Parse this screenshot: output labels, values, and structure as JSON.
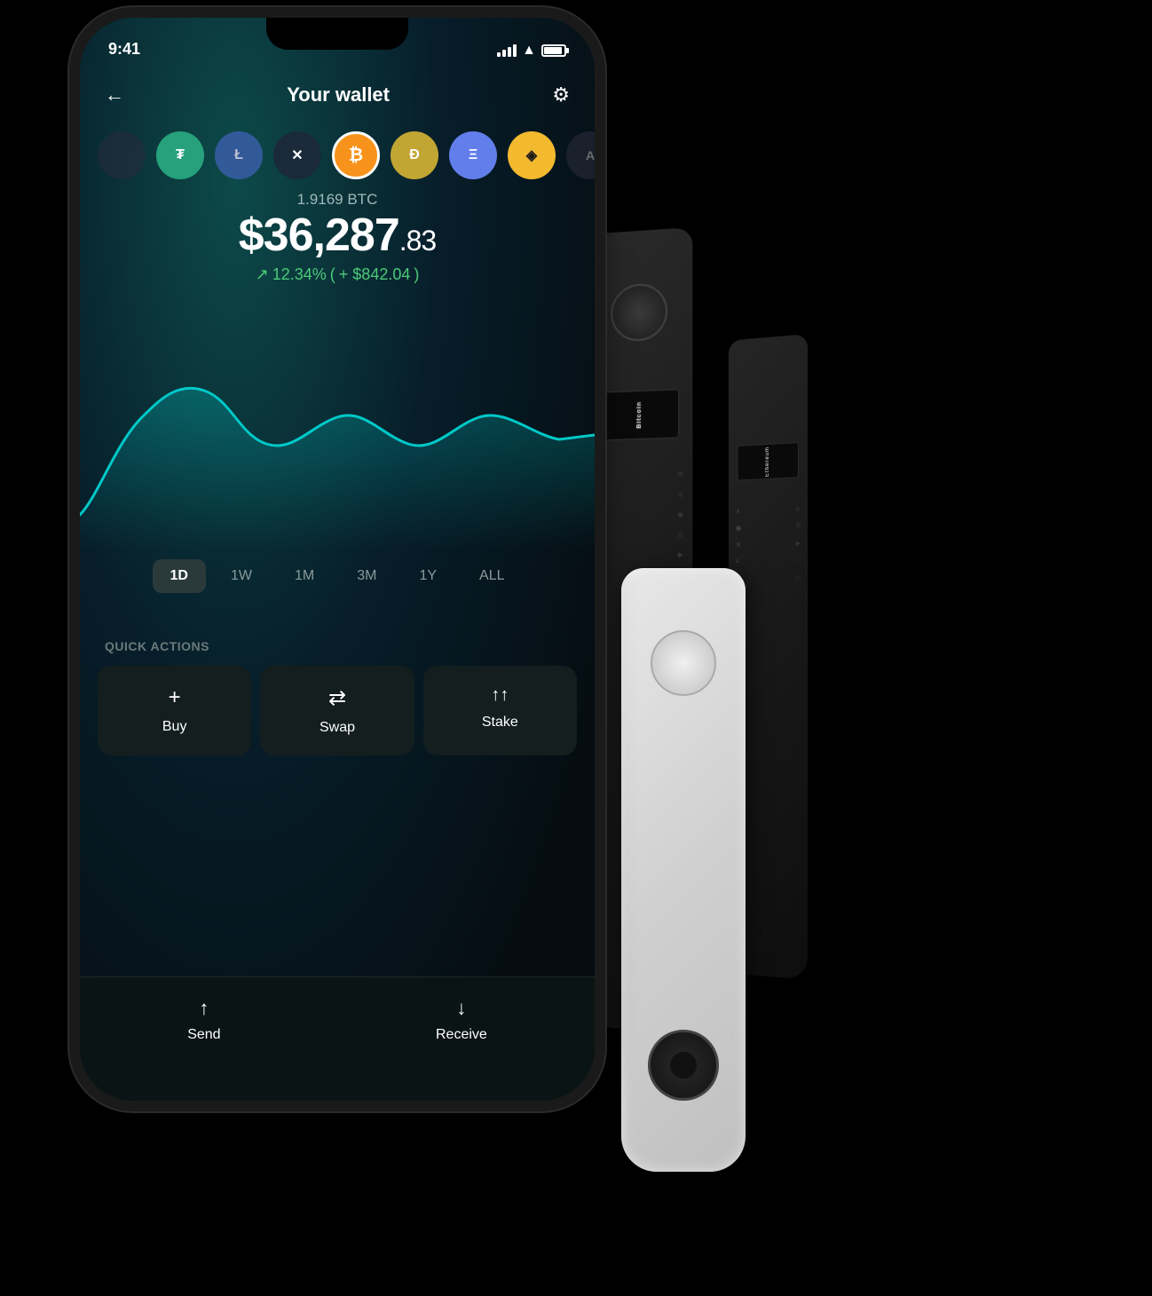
{
  "page": {
    "background": "#000"
  },
  "statusBar": {
    "time": "9:41"
  },
  "header": {
    "title": "Your wallet",
    "backLabel": "←",
    "settingsLabel": "⚙"
  },
  "coins": [
    {
      "id": "partial-left",
      "symbol": "●",
      "class": "coin-algo coin-partial",
      "active": false
    },
    {
      "id": "tether",
      "symbol": "₮",
      "class": "coin-tether",
      "active": false
    },
    {
      "id": "litecoin",
      "symbol": "Ł",
      "class": "coin-litecoin",
      "active": false
    },
    {
      "id": "xrp",
      "symbol": "✕",
      "class": "coin-xrp",
      "active": false
    },
    {
      "id": "bitcoin",
      "symbol": "₿",
      "class": "coin-bitcoin",
      "active": true
    },
    {
      "id": "dogecoin",
      "symbol": "Ð",
      "class": "coin-dogecoin",
      "active": false
    },
    {
      "id": "ethereum",
      "symbol": "Ξ",
      "class": "coin-ethereum",
      "active": false
    },
    {
      "id": "binance",
      "symbol": "◈",
      "class": "coin-binance",
      "active": false
    },
    {
      "id": "algo",
      "symbol": "A",
      "class": "coin-algo",
      "active": false
    }
  ],
  "balance": {
    "cryptoAmount": "1.9169 BTC",
    "fiatMain": "$36,287",
    "fiatCents": ".83",
    "changePercent": "12.34%",
    "changeAmount": "+ $842.04",
    "changeArrow": "↗"
  },
  "timeRanges": [
    {
      "label": "1D",
      "active": true
    },
    {
      "label": "1W",
      "active": false
    },
    {
      "label": "1M",
      "active": false
    },
    {
      "label": "3M",
      "active": false
    },
    {
      "label": "1Y",
      "active": false
    },
    {
      "label": "ALL",
      "active": false
    }
  ],
  "quickActions": {
    "sectionLabel": "QUICK ACTIONS",
    "buttons": [
      {
        "id": "buy",
        "icon": "+",
        "label": "Buy"
      },
      {
        "id": "swap",
        "icon": "⇄",
        "label": "Swap"
      },
      {
        "id": "stake",
        "icon": "↑↑",
        "label": "Stake"
      }
    ]
  },
  "bottomBar": {
    "buttons": [
      {
        "id": "send",
        "icon": "↑",
        "label": "Send"
      },
      {
        "id": "receive",
        "icon": "↓",
        "label": "Receive"
      }
    ]
  },
  "ledgerDevices": {
    "nanoX": {
      "screenText": "Bitcoin"
    },
    "nanoS": {
      "screenText": "Ethereum"
    },
    "nanoWhite": {}
  }
}
